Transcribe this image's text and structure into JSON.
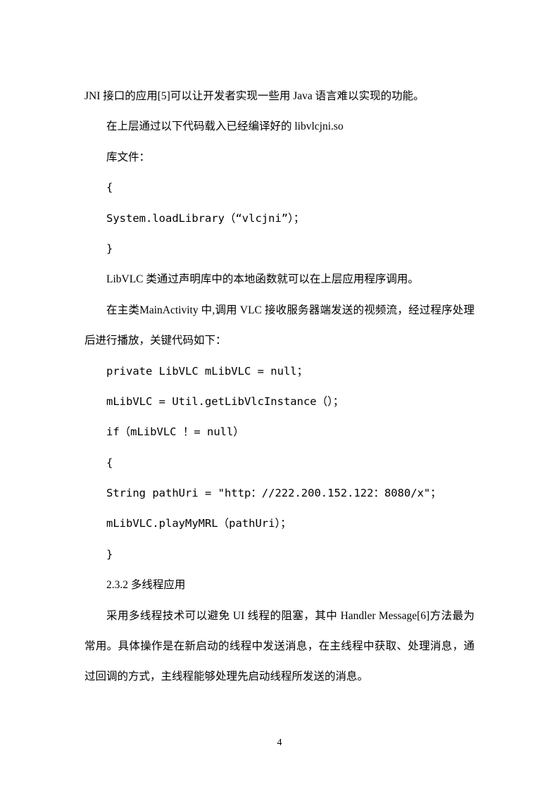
{
  "content": {
    "p1": "JNI 接口的应用[5]可以让开发者实现一些用 Java 语言难以实现的功能。",
    "p2": "在上层通过以下代码载入已经编译好的 libvlcjni.so",
    "p3": "库文件：",
    "p4": "{",
    "p5": "System.loadLibrary（“vlcjni”）；",
    "p6": "}",
    "p7": "LibVLC 类通过声明库中的本地函数就可以在上层应用程序调用。",
    "p8": "在主类MainActivity 中,调用 VLC 接收服务器端发送的视频流，经过程序处理后进行播放，关键代码如下：",
    "p9": "private LibVLC mLibVLC = null；",
    "p10": "mLibVLC = Util.getLibVlcInstance（）；",
    "p11": "if（mLibVLC ！= null）",
    "p12": "{",
    "p13": "String pathUri = \"http：//222.200.152.122：8080/x\"；",
    "p14": "mLibVLC.playMyMRL（pathUri）；",
    "p15": "}",
    "p16": "2.3.2 多线程应用",
    "p17": "采用多线程技术可以避免 UI 线程的阻塞，其中 Handler Message[6]方法最为常用。具体操作是在新启动的线程中发送消息，在主线程中获取、处理消息，通过回调的方式，主线程能够处理先启动线程所发送的消息。"
  },
  "pageNumber": "4"
}
